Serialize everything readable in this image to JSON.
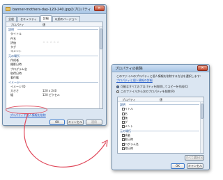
{
  "window1": {
    "title": "banner-mothers-day-120-240.jpgのプロパティ",
    "close_label": "✕",
    "tabs": [
      "全般",
      "セキュリティ",
      "詳細",
      "以前のバージョン"
    ],
    "columns": {
      "property": "プロパティ",
      "value": "値"
    },
    "rows": [
      {
        "section": "説明"
      },
      {
        "label": "タイトル",
        "value": ""
      },
      {
        "label": "件名",
        "value": ""
      },
      {
        "label": "評価",
        "value": "☆☆☆☆☆"
      },
      {
        "label": "タグ",
        "value": ""
      },
      {
        "label": "コメント",
        "value": ""
      },
      {
        "section": "元の場所"
      },
      {
        "label": "作成者",
        "value": ""
      },
      {
        "label": "撮影日時",
        "value": ""
      },
      {
        "label": "プログラム名",
        "value": ""
      },
      {
        "label": "取得日時",
        "value": ""
      },
      {
        "label": "著作権",
        "value": ""
      },
      {
        "section": "イメージ"
      },
      {
        "label": "イメージ ID",
        "value": ""
      },
      {
        "label": "大きさ",
        "value": "120 x 240"
      },
      {
        "label": "幅",
        "value": "120 ピクセル"
      }
    ],
    "remove_link": "プロパティや個人情報を削除",
    "ok_label": "OK",
    "cancel_label": "キャンセル",
    "apply_label": "適用"
  },
  "window2": {
    "title": "プロパティの削除",
    "intro_line1": "このファイルのプロパティと個人情報を削除する方法を選択します:",
    "intro_link": "プロパティと個人情報の詳細",
    "option_copy": "可能なすべてのプロパティを削除してコピーを作成(C)",
    "option_remove": "このファイルから次のプロパティを削除(R)",
    "columns": {
      "property": "プロパティ",
      "value": "値"
    },
    "rows": [
      {
        "section": "説明"
      },
      {
        "label": "タイトル"
      },
      {
        "label": "件名"
      },
      {
        "label": "評価"
      },
      {
        "label": "タグ"
      },
      {
        "label": "コメント"
      },
      {
        "section": "元の場所"
      },
      {
        "label": "作成者"
      },
      {
        "label": "撮影日時"
      },
      {
        "label": "プログラム名"
      },
      {
        "label": "取得日時"
      }
    ],
    "select_all_label": "すべて選択(S)",
    "ok_label": "OK",
    "cancel_label": "キャンセル"
  },
  "annotation_color": "#e0485a"
}
